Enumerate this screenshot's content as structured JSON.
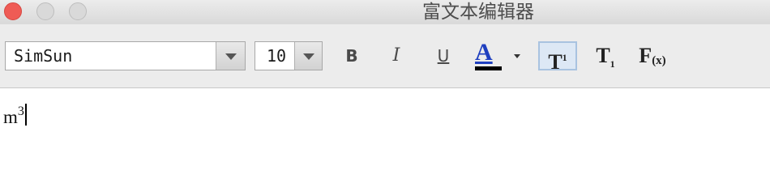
{
  "window": {
    "title": "富文本编辑器"
  },
  "toolbar": {
    "font_family": "SimSun",
    "font_size": "10",
    "bold_label": "B",
    "italic_label": "I",
    "underline_label": "U",
    "text_color_label": "A",
    "text_color": "#000000",
    "superscript_label": "T",
    "superscript_mark": "1",
    "superscript_active": true,
    "subscript_label": "T",
    "subscript_mark": "1",
    "formula_label": "F",
    "formula_mark": "(x)"
  },
  "editor": {
    "base_text": "m",
    "superscript_text": "3"
  },
  "colors": {
    "close_button": "#ef5b55",
    "color_icon_letter": "#1f3fbf",
    "active_tool_bg": "#dde8f5"
  }
}
